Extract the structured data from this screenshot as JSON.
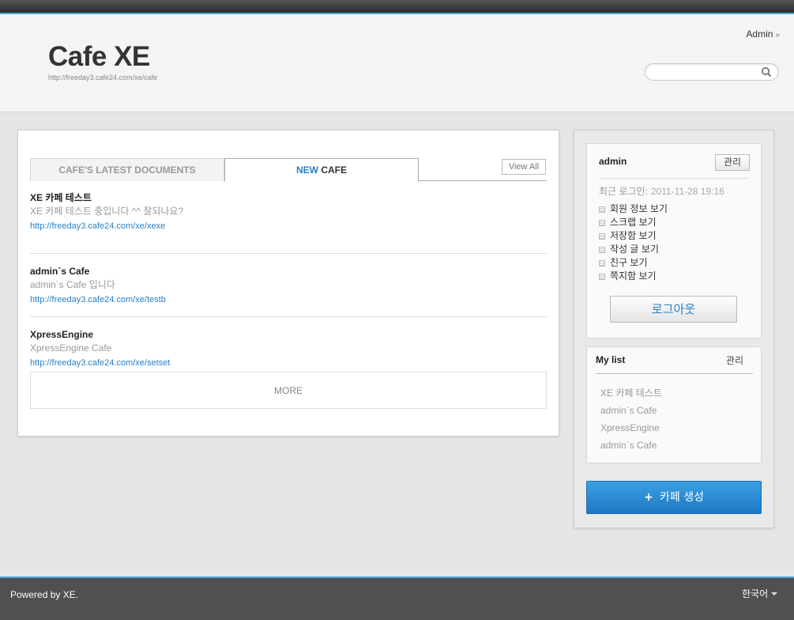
{
  "header": {
    "title": "Cafe XE",
    "url": "http://freeday3.cafe24.com/xe/cafe",
    "admin_link": "Admin",
    "admin_arrow": "»",
    "search_placeholder": "",
    "search_icon": "magnifier"
  },
  "main": {
    "tabs": [
      {
        "label": "CAFE'S LATEST DOCUMENTS"
      },
      {
        "label_highlight": "NEW",
        "label_rest": "CAFE"
      }
    ],
    "view_all": "View All",
    "cafes": [
      {
        "name": "XE 카페 테스트",
        "description": "XE 카페 테스트 중입니다 ^^ 잘되나요?",
        "url": "http://freeday3.cafe24.com/xe/xexe"
      },
      {
        "name": "admin`s Cafe",
        "description": "admin`s Cafe 입니다",
        "url": "http://freeday3.cafe24.com/xe/testb"
      },
      {
        "name": "XpressEngine",
        "description": "XpressEngine Cafe",
        "url": "http://freeday3.cafe24.com/xe/setset"
      }
    ],
    "more": "MORE"
  },
  "sidebar": {
    "login": {
      "user": "admin",
      "manage": "관리",
      "last_login_label": "최근 로그인:",
      "last_login_time": "2011-11-28 19:16",
      "menu": [
        "회원 정보 보기",
        "스크랩 보기",
        "저장함 보기",
        "작성 글 보기",
        "친구 보기",
        "쪽지함 보기"
      ],
      "logout": "로그아웃"
    },
    "mylist": {
      "title": "My list",
      "manage": "관리",
      "items": [
        "XE 카페 테스트",
        "admin`s Cafe",
        "XpressEngine",
        "admin`s Cafe"
      ]
    },
    "create_button": "카페 생성",
    "create_icon": "+"
  },
  "footer": {
    "powered": "Powered by XE.",
    "language": "한국어"
  },
  "colors": {
    "accent": "#2a80c4",
    "topbar_line": "#4aa3d8",
    "footer_bg": "#505050",
    "create_button": "#2a8ad6"
  }
}
